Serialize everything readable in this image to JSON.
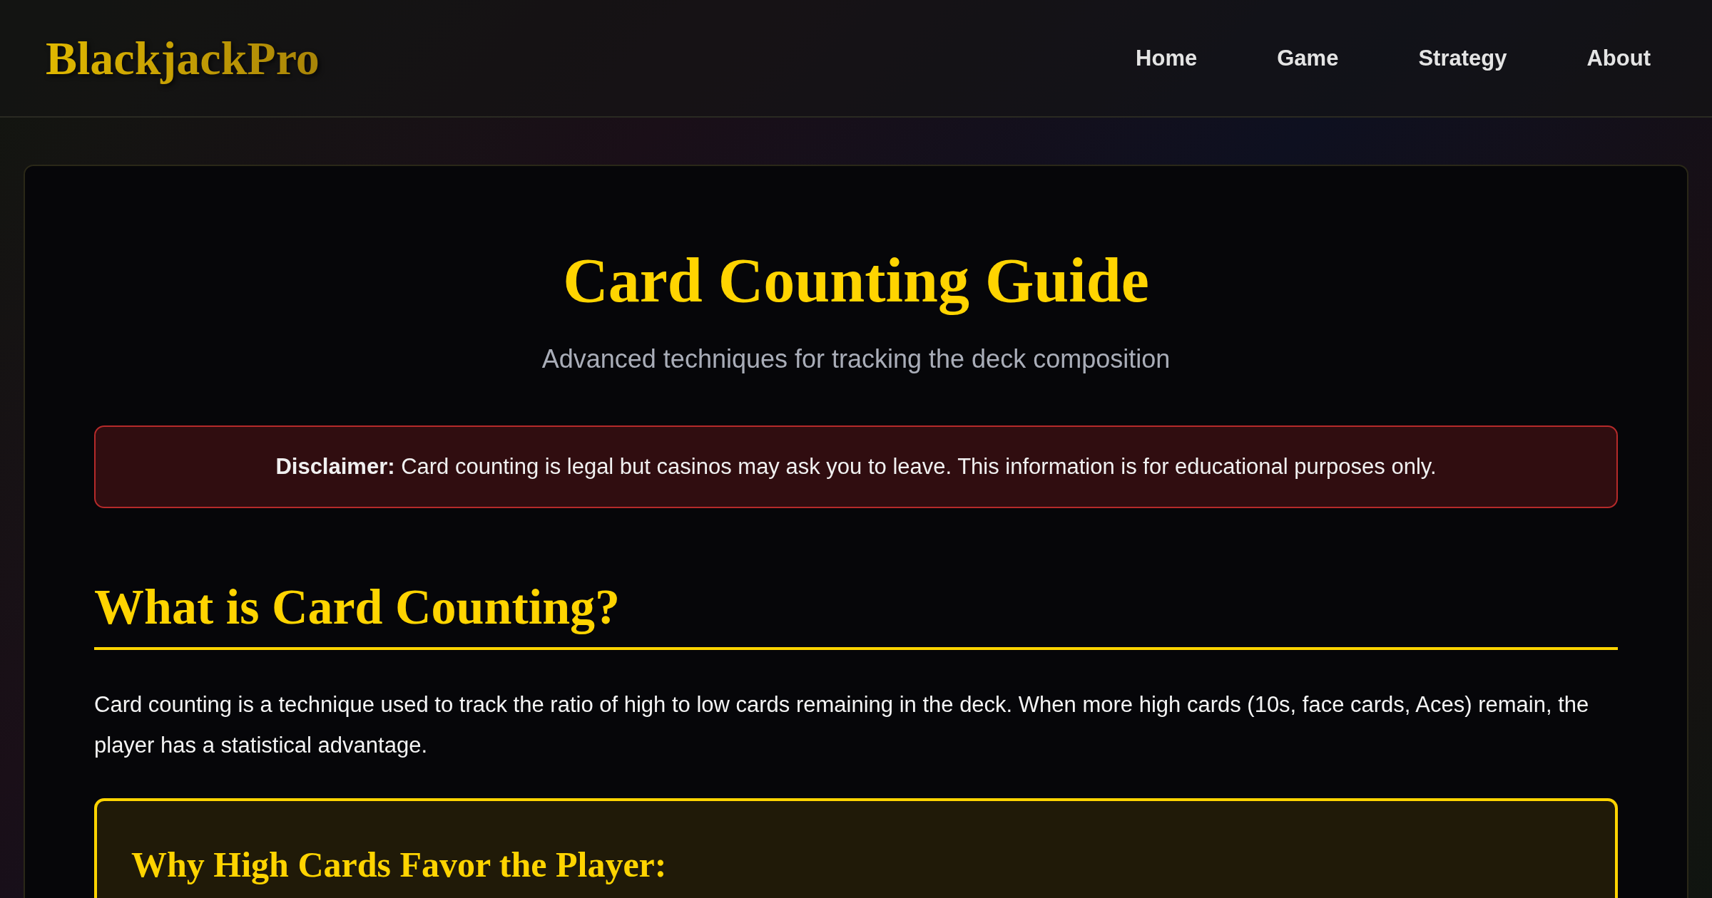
{
  "header": {
    "logo": "BlackjackPro",
    "nav": [
      {
        "label": "Home"
      },
      {
        "label": "Game"
      },
      {
        "label": "Strategy"
      },
      {
        "label": "About"
      }
    ]
  },
  "page": {
    "title": "Card Counting Guide",
    "subtitle": "Advanced techniques for tracking the deck composition",
    "disclaimer": "**Disclaimer:** Card counting is legal but casinos may ask you to leave. This information is for educational purposes only.",
    "section": {
      "heading": "What is Card Counting?",
      "paragraph": "Card counting is a technique used to track the ratio of high to low cards remaining in the deck. When more high cards (10s, face cards, Aces) remain, the player has a statistical advantage.",
      "callout": {
        "heading": "Why High Cards Favor the Player:"
      }
    }
  }
}
